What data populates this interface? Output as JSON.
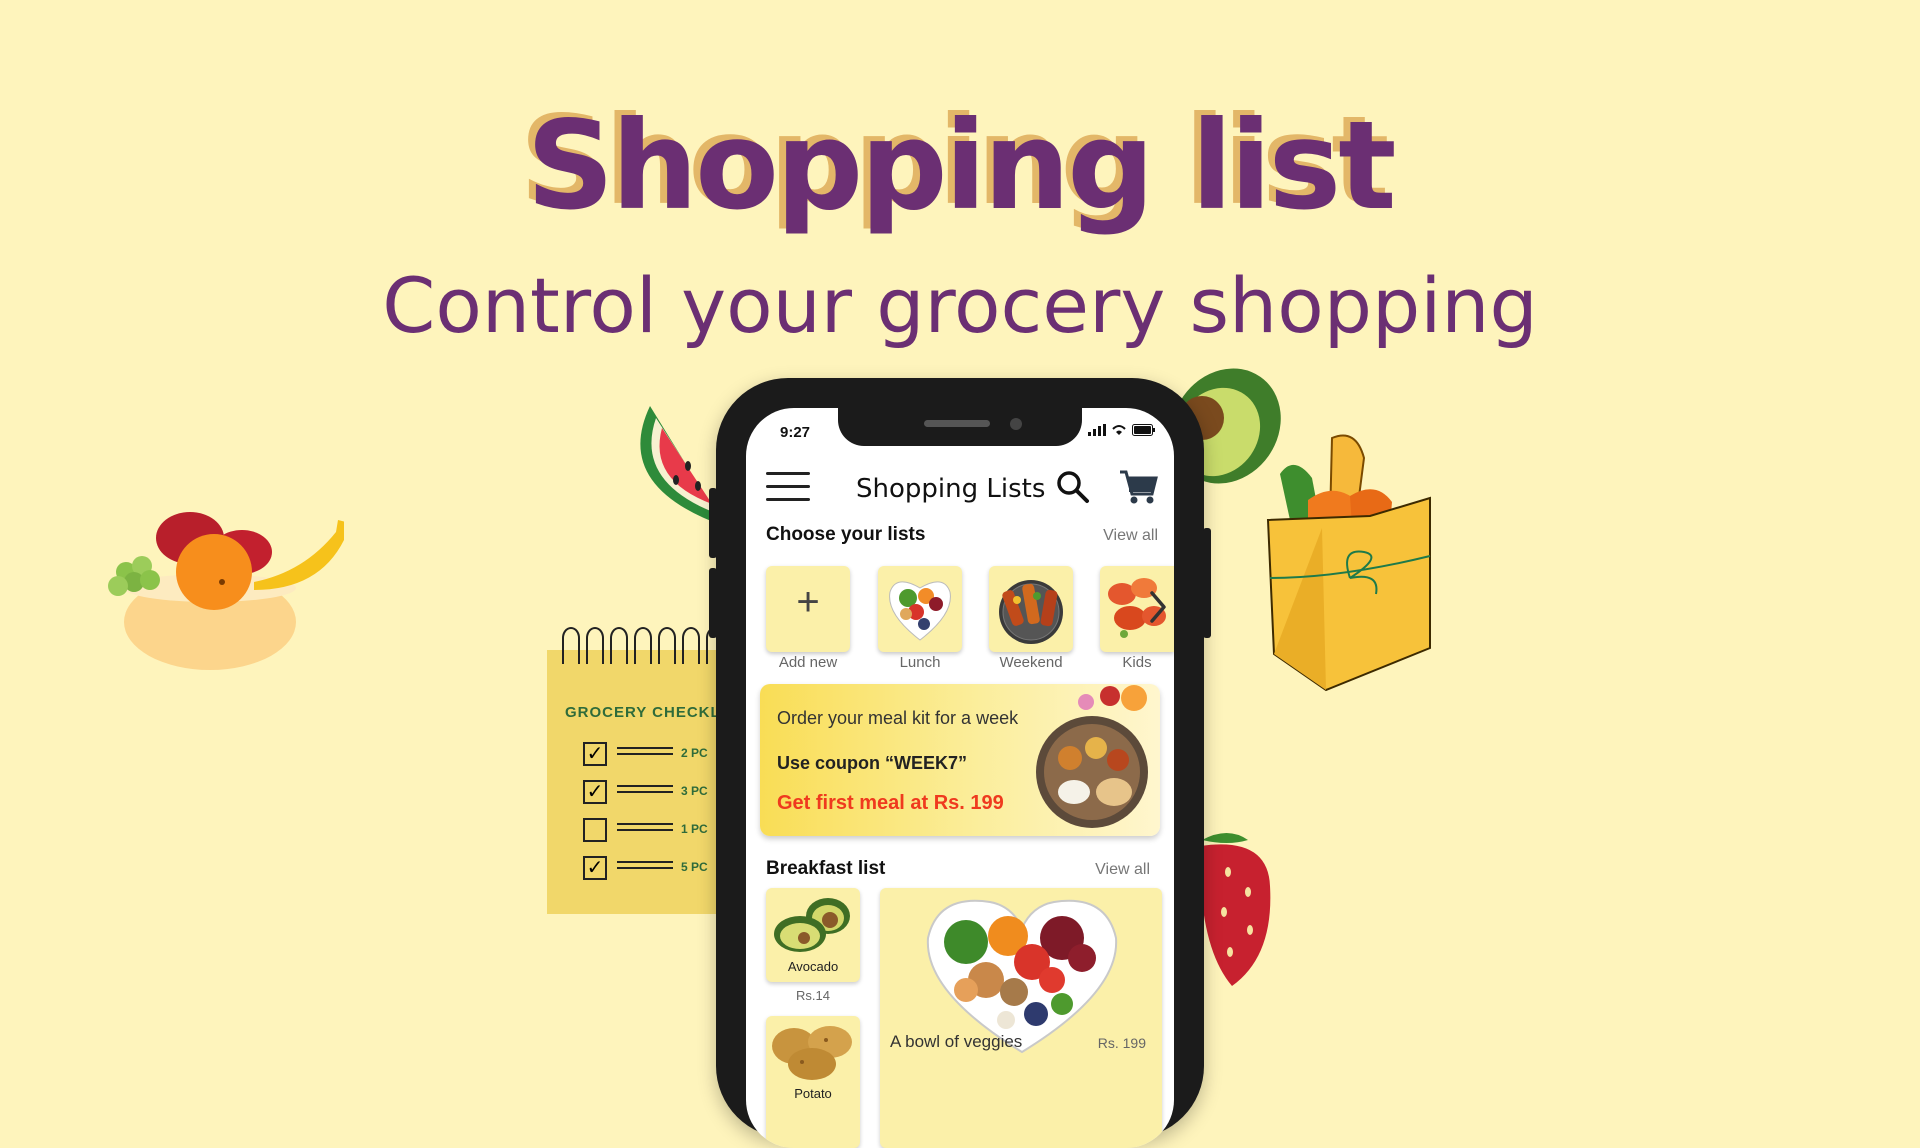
{
  "hero": {
    "title": "Shopping list",
    "subtitle": "Control your grocery shopping"
  },
  "checklist": {
    "heading": "GROCERY CHECKL",
    "items": [
      {
        "checked": true,
        "qty": "2 PC"
      },
      {
        "checked": true,
        "qty": "3 PC"
      },
      {
        "checked": false,
        "qty": "1 PC"
      },
      {
        "checked": true,
        "qty": "5 PC"
      }
    ]
  },
  "phone": {
    "status_time": "9:27",
    "app_title": "Shopping Lists",
    "icons": {
      "menu": "hamburger-menu-icon",
      "search": "search-icon",
      "cart": "cart-icon",
      "next": "chevron-right-icon"
    },
    "lists_section": {
      "title": "Choose your lists",
      "view_all": "View all",
      "items": [
        {
          "label": "Add new",
          "icon": "plus-icon"
        },
        {
          "label": "Lunch",
          "icon": "veggie-heart-image"
        },
        {
          "label": "Weekend",
          "icon": "bbq-grill-image"
        },
        {
          "label": "Kids",
          "icon": "nuggets-image"
        }
      ]
    },
    "promo": {
      "line1": "Order your meal kit for a week",
      "line2": "Use coupon “WEEK7”",
      "line3": "Get first meal at Rs. 199"
    },
    "breakfast_section": {
      "title": "Breakfast list",
      "view_all": "View all",
      "products": [
        {
          "name": "Avocado",
          "price": "Rs.14"
        },
        {
          "name": "Potato",
          "price": ""
        }
      ],
      "featured": {
        "name": "A bowl of veggies",
        "price": "Rs. 199"
      }
    }
  },
  "colors": {
    "background": "#FEF4BC",
    "title_purple": "#6B2F73",
    "title_shadow": "#E3B768",
    "tile_yellow": "#FBF0A9",
    "promo_red": "#EF3A1E"
  }
}
